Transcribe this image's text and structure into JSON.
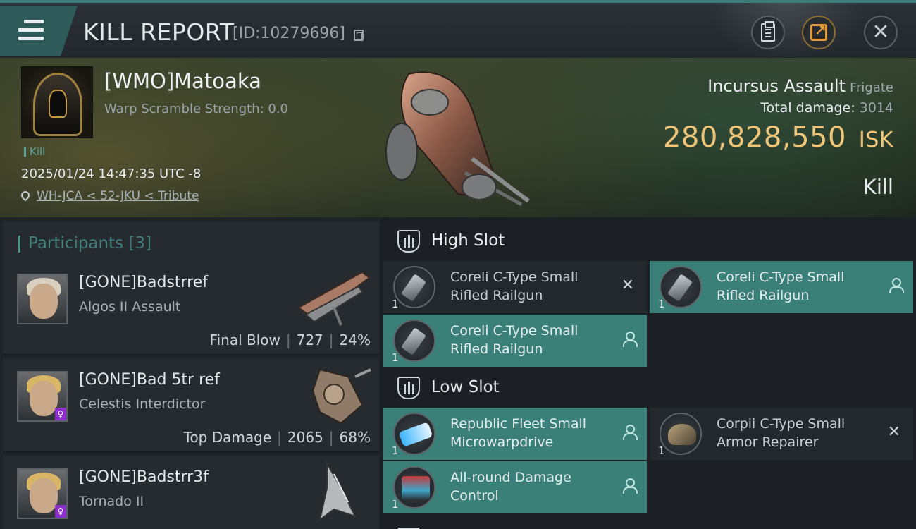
{
  "header": {
    "title": "KILL REPORT",
    "report_id": "[ID:10279696]",
    "menu_icon": "hamburger-icon",
    "actions": [
      "clipboard-icon",
      "share-icon",
      "close-icon"
    ]
  },
  "victim": {
    "pilot": "[WMO]Matoaka",
    "warp_scramble": "Warp Scramble Strength: 0.0",
    "tag": "Kill",
    "datetime": "2025/01/24 14:47:35 UTC -8",
    "location": "WH-JCA < 52-JKU < Tribute",
    "ship": "Incursus Assault",
    "ship_class": "Frigate",
    "total_damage_label": "Total damage:",
    "total_damage": "3014",
    "isk_value": "280,828,550",
    "isk_unit": "ISK",
    "result": "Kill"
  },
  "participants": {
    "label": "Participants",
    "count": "[3]",
    "items": [
      {
        "name": "[GONE]Badstrref",
        "ship": "Algos II Assault",
        "role": "Final Blow",
        "damage": "727",
        "percent": "24%"
      },
      {
        "name": "[GONE]Bad 5tr ref",
        "ship": "Celestis Interdictor",
        "role": "Top Damage",
        "damage": "2065",
        "percent": "68%"
      },
      {
        "name": "[GONE]Badstrr3f",
        "ship": "Tornado II",
        "role": "",
        "damage": "",
        "percent": ""
      }
    ]
  },
  "fitting": {
    "high_slot": {
      "label": "High Slot",
      "items": [
        {
          "qty": "1",
          "name": "Coreli C-Type Small Rifled Railgun",
          "state": "destroyed"
        },
        {
          "qty": "1",
          "name": "Coreli C-Type Small Rifled Railgun",
          "state": "dropped"
        },
        {
          "qty": "1",
          "name": "Coreli C-Type Small Rifled Railgun",
          "state": "dropped"
        }
      ]
    },
    "low_slot": {
      "label": "Low Slot",
      "items": [
        {
          "qty": "1",
          "name": "Republic Fleet Small Microwarpdrive",
          "state": "dropped"
        },
        {
          "qty": "1",
          "name": "Corpii C-Type Small Armor Repairer",
          "state": "destroyed"
        },
        {
          "qty": "1",
          "name": "All-round Damage Control",
          "state": "dropped"
        }
      ]
    }
  },
  "colors": {
    "accent_teal": "#3b7f79",
    "isk_gold": "#efc679",
    "header_bar": "#2f5b5a"
  }
}
